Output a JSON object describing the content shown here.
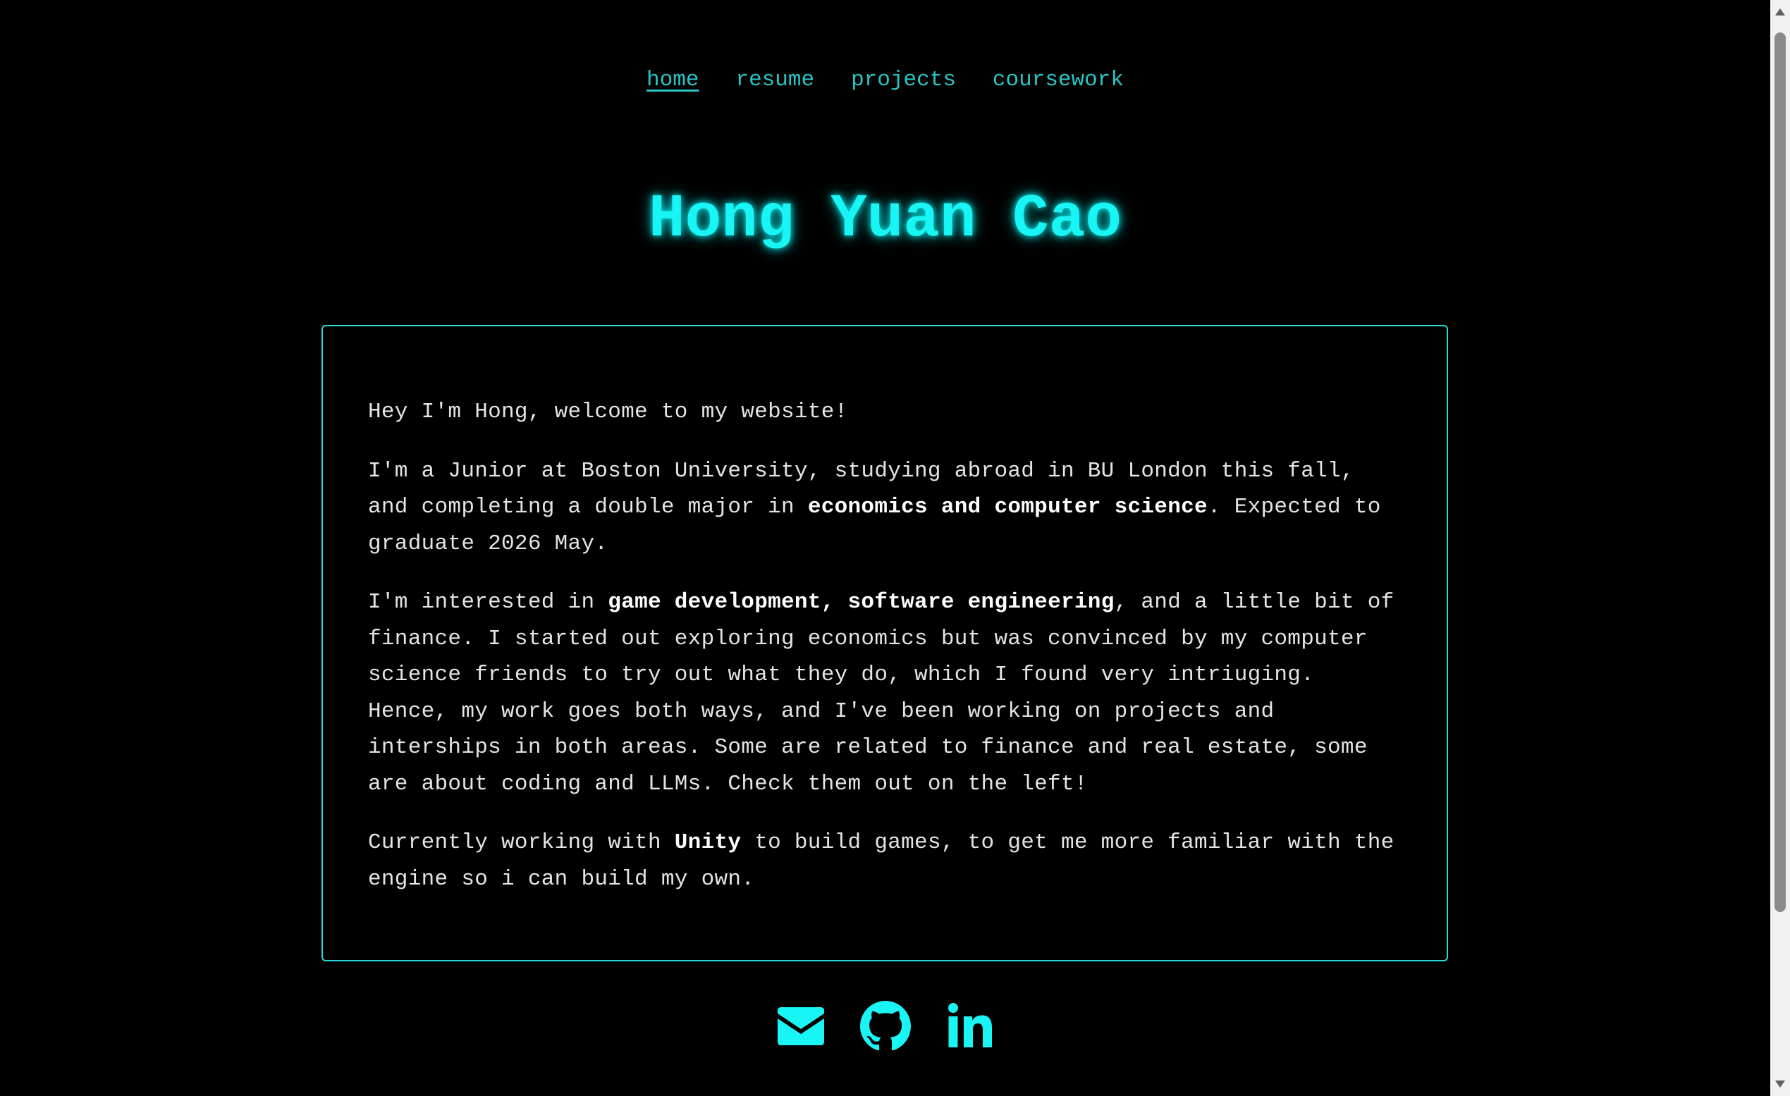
{
  "nav": [
    {
      "label": "home",
      "active": true
    },
    {
      "label": "resume",
      "active": false
    },
    {
      "label": "projects",
      "active": false
    },
    {
      "label": "coursework",
      "active": false
    }
  ],
  "title": "Hong Yuan Cao",
  "intro": {
    "p1": "Hey I'm Hong, welcome to my website!",
    "p2": {
      "a": "I'm a Junior at Boston University, studying abroad in BU London this fall, and completing a double major in ",
      "b": "economics and computer science",
      "c": ". Expected to graduate 2026 May."
    },
    "p3": {
      "a": "I'm interested in ",
      "b1": "game development",
      "sep": ", ",
      "b2": "software engineering",
      "c": ", and a little bit of finance. I started out exploring economics but was convinced by my computer science friends to try out what they do, which I found very intriuging. Hence, my work goes both ways, and I've been working on projects and interships in both areas. Some are related to finance and real estate, some are about coding and LLMs. Check them out on the left!"
    },
    "p4": {
      "a": "Currently working with ",
      "b": "Unity",
      "c": " to build games, to get me more familiar with the engine so i can build my own."
    }
  },
  "social": [
    {
      "icon": "envelope-icon"
    },
    {
      "icon": "github-icon"
    },
    {
      "icon": "linkedin-icon"
    }
  ],
  "colors": {
    "background": "#000000",
    "accent": "#19f5f5",
    "nav": "#29c5c5",
    "border": "#2ad6d6",
    "text": "#e4e4e4"
  }
}
